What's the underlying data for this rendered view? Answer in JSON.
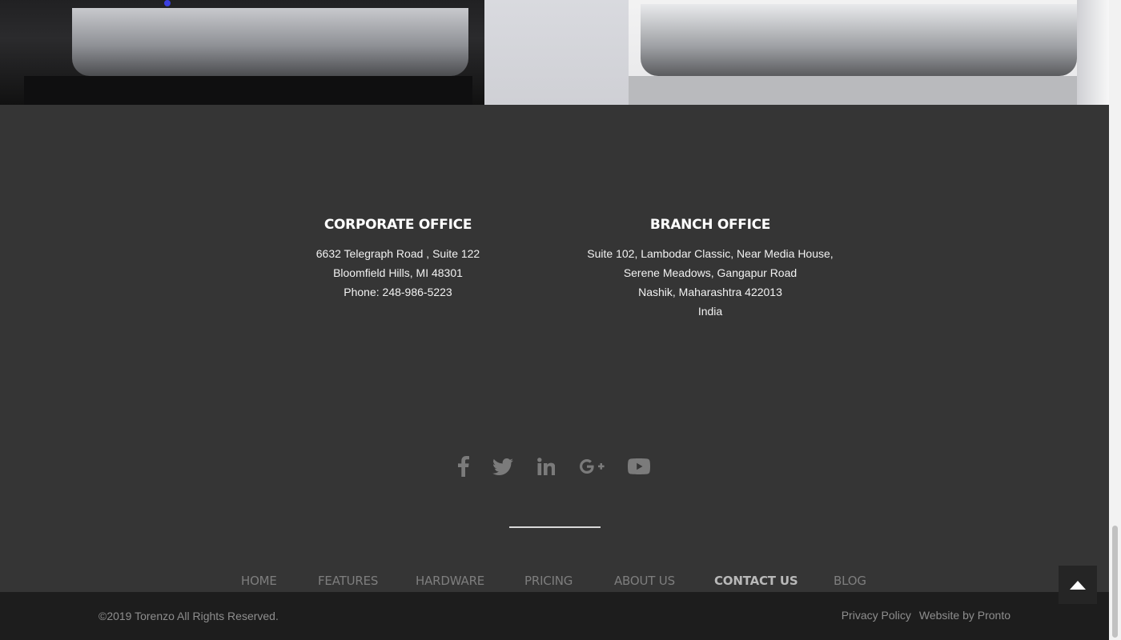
{
  "offices": {
    "corporate": {
      "title": "CORPORATE OFFICE",
      "lines": [
        "6632 Telegraph Road , Suite 122",
        "Bloomfield Hills, MI 48301",
        "Phone: 248-986-5223"
      ]
    },
    "branch": {
      "title": "BRANCH OFFICE",
      "lines": [
        "Suite 102, Lambodar Classic, Near Media House,",
        "Serene Meadows, Gangapur Road",
        "Nashik, Maharashtra 422013",
        "India"
      ]
    }
  },
  "social": {
    "icons": [
      "facebook-icon",
      "twitter-icon",
      "linkedin-icon",
      "google-plus-icon",
      "youtube-icon"
    ],
    "icon_color": "#7b7b7b"
  },
  "nav": {
    "items": [
      "HOME",
      "FEATURES",
      "HARDWARE",
      "PRICING",
      "ABOUT US",
      "CONTACT US",
      "BLOG"
    ],
    "active": "CONTACT US"
  },
  "footer": {
    "copyright": "©2019 Torenzo All Rights Reserved.",
    "privacy": "Privacy Policy",
    "credit": "Website by Pronto"
  },
  "colors": {
    "footer_bg": "#353535",
    "bottom_bar_bg": "#1d1d1d",
    "nav_text": "#7e7e7e",
    "nav_active": "#b9b9b9"
  }
}
